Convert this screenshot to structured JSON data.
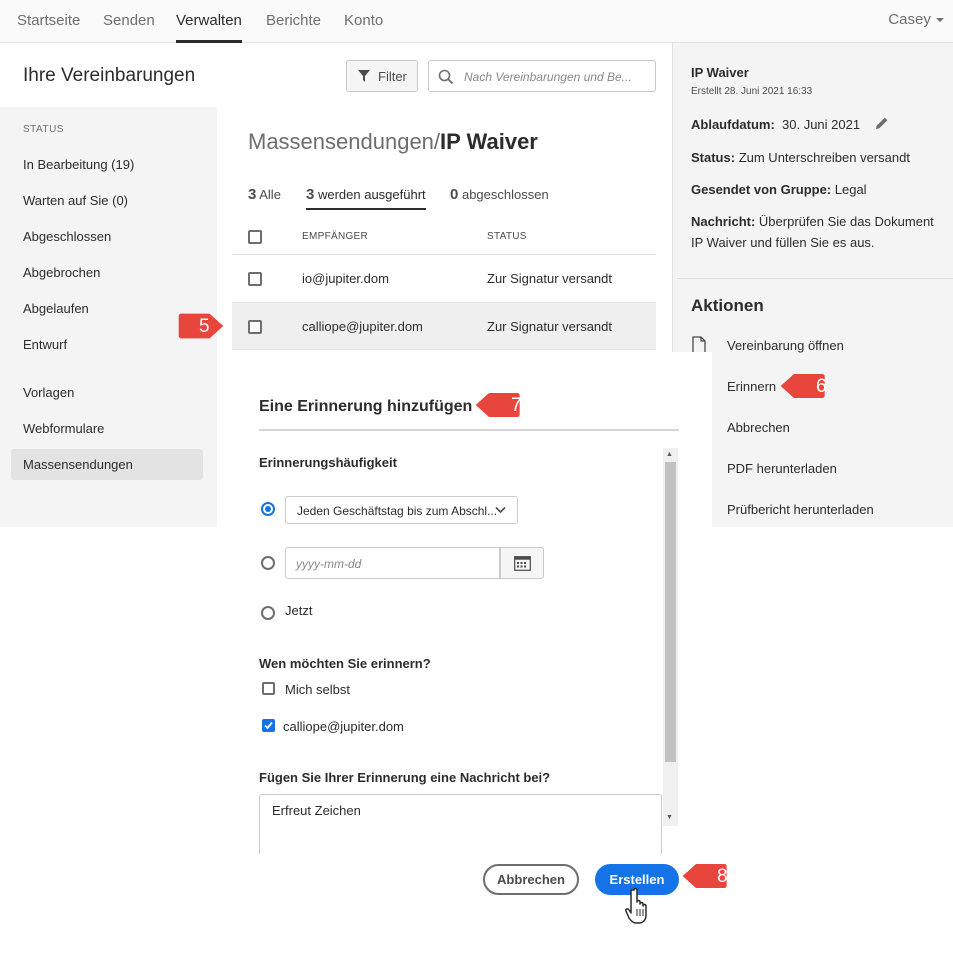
{
  "topnav": {
    "tabs": [
      "Startseite",
      "Senden",
      "Verwalten",
      "Berichte",
      "Konto"
    ],
    "active_tab": "Verwalten",
    "user": "Casey"
  },
  "header": {
    "title": "Ihre Vereinbarungen",
    "filter_label": "Filter",
    "search_placeholder": "Nach Vereinbarungen und Be..."
  },
  "sidebar": {
    "heading": "STATUS",
    "items": [
      "In Bearbeitung (19)",
      "Warten auf Sie (0)",
      "Abgeschlossen",
      "Abgebrochen",
      "Abgelaufen",
      "Entwurf"
    ],
    "items2": [
      "Vorlagen",
      "Webformulare",
      "Massensendungen"
    ],
    "selected": "Massensendungen"
  },
  "main": {
    "crumb_prefix": "Massensendungen/",
    "crumb_title": "IP Waiver",
    "subtabs": [
      {
        "count": "3",
        "label": "Alle"
      },
      {
        "count": "3",
        "label": "werden ausgeführt"
      },
      {
        "count": "0",
        "label": "abgeschlossen"
      }
    ],
    "columns": [
      "EMPFÄNGER",
      "STATUS"
    ],
    "rows": [
      {
        "recipient": "io@jupiter.dom",
        "status": "Zur Signatur versandt"
      },
      {
        "recipient": "calliope@jupiter.dom",
        "status": "Zur Signatur versandt"
      }
    ]
  },
  "details": {
    "title": "IP Waiver",
    "created": "Erstellt 28. Juni 2021 16:33",
    "expiry_label": "Ablaufdatum:",
    "expiry_value": "30. Juni 2021",
    "status_label": "Status:",
    "status_value": "Zum Unterschreiben versandt",
    "group_label": "Gesendet von Gruppe:",
    "group_value": "Legal",
    "message_label": "Nachricht:",
    "message_line1": "Überprüfen Sie das Dokument",
    "message_line2": "IP Waiver und füllen Sie es aus.",
    "actions_heading": "Aktionen",
    "actions": [
      "Vereinbarung öffnen",
      "Erinnern",
      "Abbrechen",
      "PDF herunterladen",
      "Prüfbericht herunterladen"
    ]
  },
  "modal": {
    "title": "Eine Erinnerung hinzufügen",
    "frequency_label": "Erinnerungshäufigkeit",
    "frequency_value": "Jeden Geschäftstag bis zum Abschl...",
    "date_placeholder": "yyyy-mm-dd",
    "now_label": "Jetzt",
    "who_label": "Wen möchten Sie erinnern?",
    "who_options": [
      {
        "label": "Mich selbst",
        "checked": false
      },
      {
        "label": "calliope@jupiter.dom",
        "checked": true
      }
    ],
    "message_label": "Fügen Sie Ihrer Erinnerung eine Nachricht bei?",
    "message_value": "Erfreut Zeichen",
    "cancel_label": "Abbrechen",
    "create_label": "Erstellen"
  },
  "callouts": [
    "5",
    "6",
    "7",
    "8"
  ],
  "colors": {
    "accent": "#1473e6",
    "callout": "#e8453c",
    "sidebar_bg": "#f4f4f4"
  }
}
